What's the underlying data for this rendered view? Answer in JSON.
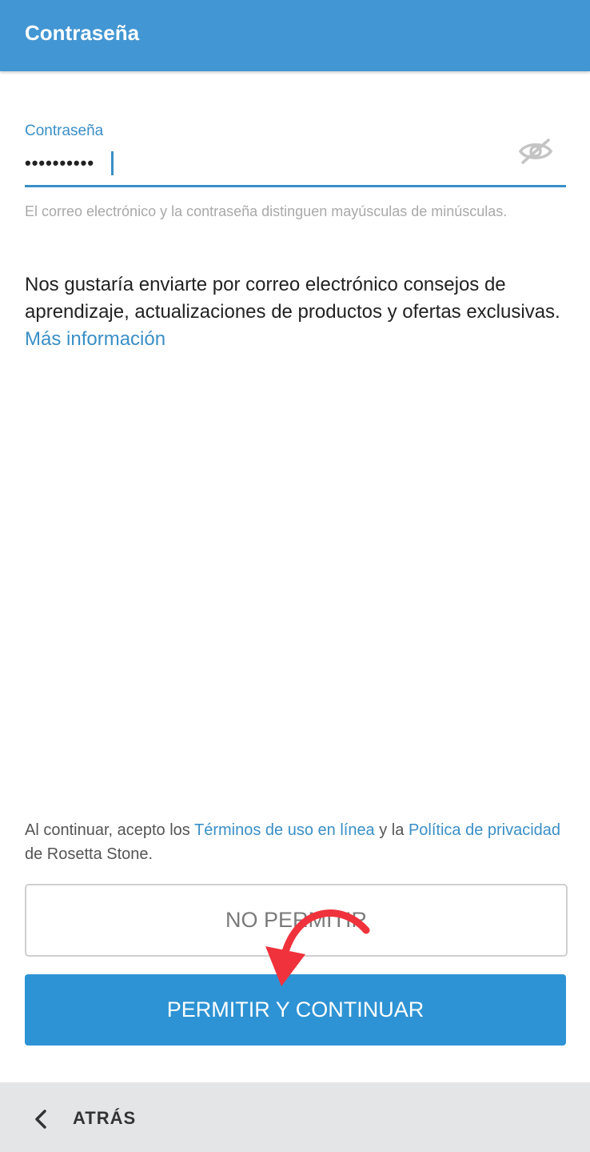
{
  "header": {
    "title": "Contraseña"
  },
  "password_field": {
    "label": "Contraseña",
    "value": "••••••••••",
    "visibility_icon": "eye-off-icon"
  },
  "helper_text": "El correo electrónico y la contraseña distinguen mayúsculas de minúsculas.",
  "consent": {
    "text": "Nos gustaría enviarte por correo electrónico consejos de aprendizaje, actualizaciones de productos y ofertas exclusivas. ",
    "link": "Más información"
  },
  "terms": {
    "prefix": "Al continuar, acepto los ",
    "terms_link": "Términos de uso en línea",
    "middle": " y la ",
    "privacy_link": "Política de privacidad",
    "suffix": " de Rosetta Stone."
  },
  "buttons": {
    "deny": "NO PERMITIR",
    "allow": "PERMITIR Y CONTINUAR"
  },
  "footer": {
    "back_label": "ATRÁS",
    "back_icon": "chevron-left-icon"
  },
  "colors": {
    "primary": "#4296d3",
    "button": "#2e93d4",
    "link": "#3a8fc7",
    "annotation_arrow": "#f0323c"
  }
}
